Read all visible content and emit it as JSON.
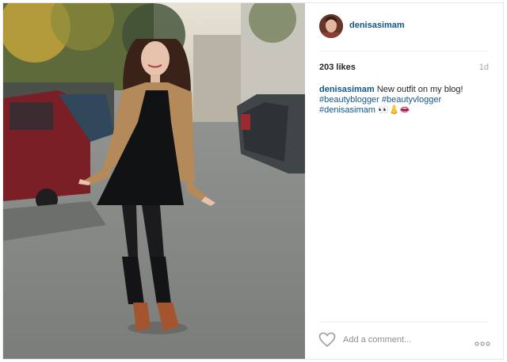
{
  "post": {
    "username": "denisasimam",
    "likes": "203 likes",
    "time_ago": "1d",
    "caption": {
      "username": "denisasimam",
      "text": "New outfit on my blog!",
      "tags": [
        "#beautyblogger",
        "#beautyvlogger",
        "#denisasimam"
      ],
      "emoji": "👀👃👄"
    },
    "comment_placeholder": "Add a comment...",
    "icons": {
      "like": "heart-icon",
      "options": "more-options-icon"
    }
  },
  "colors": {
    "link": "#125688",
    "border": "#e6e6e6",
    "muted": "#a5a7aa"
  }
}
